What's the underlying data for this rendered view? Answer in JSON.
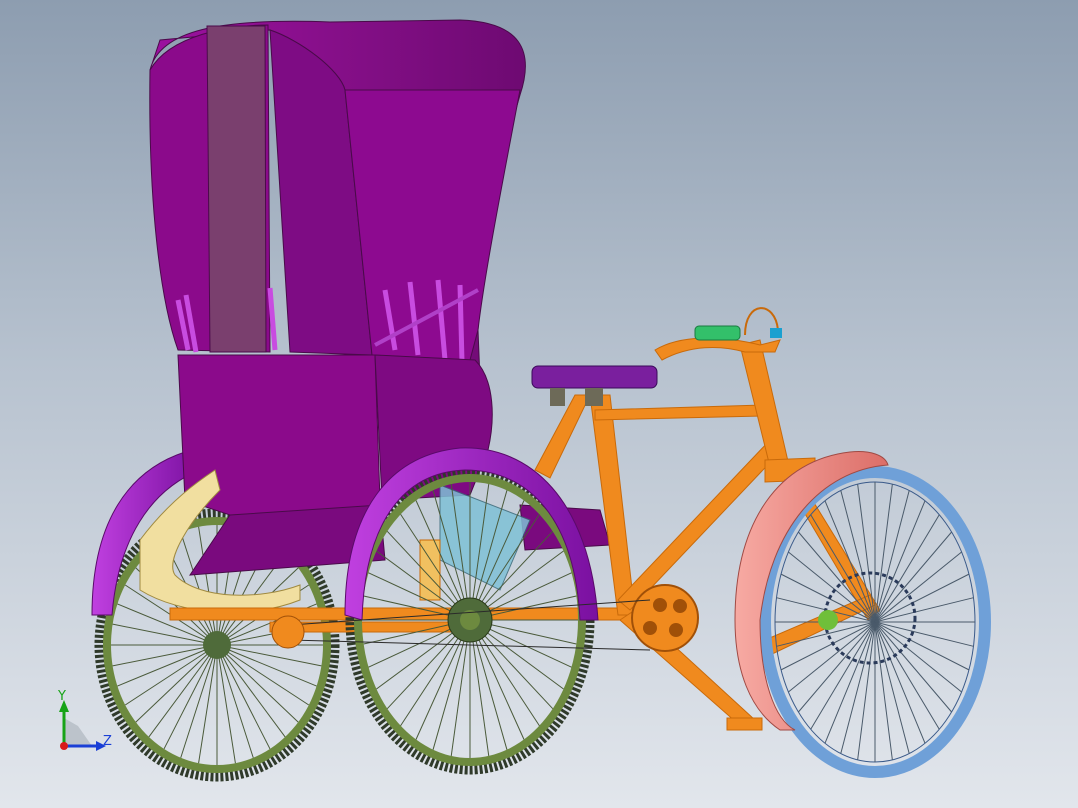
{
  "viewport": {
    "background_top": "#8d9db0",
    "background_bottom": "#e2e6ec"
  },
  "model": {
    "canopy_color": "#8b0a8b",
    "canopy_shade_color": "#6b0a6b",
    "canopy_panel_color": "#7a3f6e",
    "frame_color": "#f08a1e",
    "frame_dark_color": "#c96a0a",
    "tire_color": "#2f3a2a",
    "rear_rim_color": "#6d8a3f",
    "front_rim_color": "#6fa0d8",
    "rear_fender_color": "#a020c0",
    "front_fender_color": "#ef8c86",
    "footrest_color": "#f1dfa0",
    "panel_blue_color": "#7fc1d6",
    "seat_color": "#7a1f9e",
    "grip_color": "#33c06a",
    "hub_color": "#4f6b3a",
    "spring_color": "#6d6a58"
  },
  "triad": {
    "y_label": "Y",
    "z_label": "Z",
    "y_color": "#17a317",
    "z_color": "#1a3fd6",
    "x_color": "#d81b1b"
  }
}
